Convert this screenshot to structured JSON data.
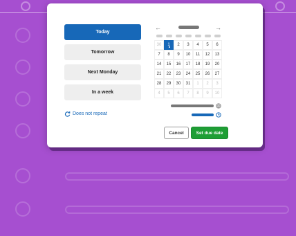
{
  "quick_options": [
    {
      "label": "Today",
      "active": true
    },
    {
      "label": "Tomorrow",
      "active": false
    },
    {
      "label": "Next Monday",
      "active": false
    },
    {
      "label": "In a week",
      "active": false
    }
  ],
  "repeat": {
    "label": "Does not repeat",
    "icon": "repeat-icon"
  },
  "calendar": {
    "prev_icon": "←",
    "next_icon": "→",
    "weeks": [
      [
        {
          "d": "30",
          "o": true
        },
        {
          "d": "1",
          "s": true
        },
        {
          "d": "2"
        },
        {
          "d": "3"
        },
        {
          "d": "4"
        },
        {
          "d": "5"
        },
        {
          "d": "6"
        }
      ],
      [
        {
          "d": "7"
        },
        {
          "d": "8"
        },
        {
          "d": "9"
        },
        {
          "d": "10"
        },
        {
          "d": "11"
        },
        {
          "d": "12"
        },
        {
          "d": "13"
        }
      ],
      [
        {
          "d": "14"
        },
        {
          "d": "15"
        },
        {
          "d": "16"
        },
        {
          "d": "17"
        },
        {
          "d": "18"
        },
        {
          "d": "19"
        },
        {
          "d": "20"
        }
      ],
      [
        {
          "d": "21"
        },
        {
          "d": "22"
        },
        {
          "d": "23"
        },
        {
          "d": "24"
        },
        {
          "d": "25"
        },
        {
          "d": "26"
        },
        {
          "d": "27"
        }
      ],
      [
        {
          "d": "28"
        },
        {
          "d": "29"
        },
        {
          "d": "30"
        },
        {
          "d": "31"
        },
        {
          "d": "1",
          "o": true
        },
        {
          "d": "2",
          "o": true
        },
        {
          "d": "3",
          "o": true
        }
      ],
      [
        {
          "d": "4",
          "o": true
        },
        {
          "d": "5",
          "o": true
        },
        {
          "d": "6",
          "o": true
        },
        {
          "d": "7",
          "o": true
        },
        {
          "d": "8",
          "o": true
        },
        {
          "d": "9",
          "o": true
        },
        {
          "d": "10",
          "o": true
        }
      ]
    ]
  },
  "actions": {
    "cancel_label": "Cancel",
    "save_label": "Set due date"
  },
  "colors": {
    "accent": "#1768b8",
    "save": "#1e9e35",
    "background": "#a64fd0"
  }
}
